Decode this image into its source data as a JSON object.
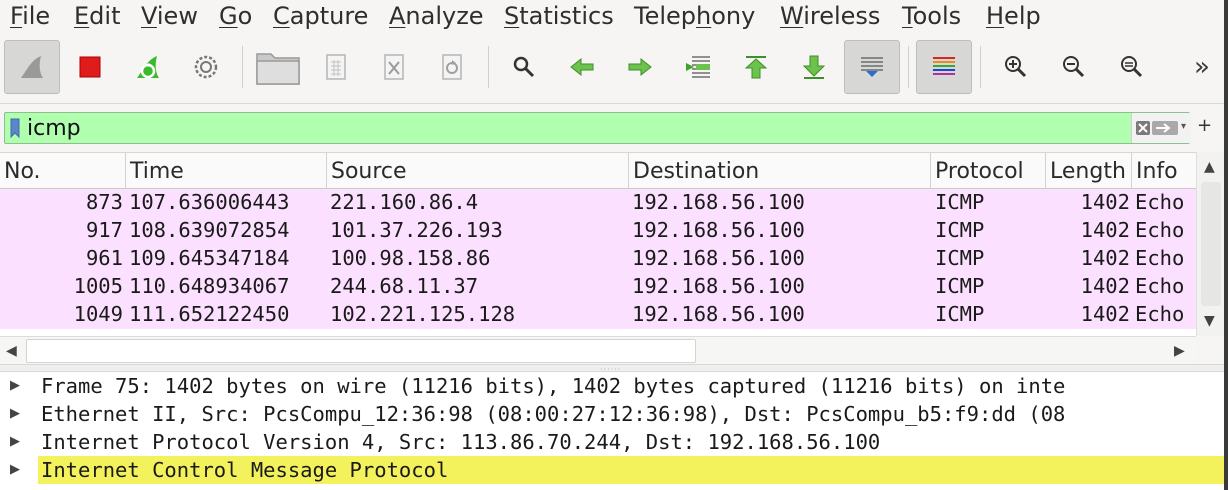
{
  "menu": [
    {
      "pre": "",
      "mn": "F",
      "post": "ile"
    },
    {
      "pre": "",
      "mn": "E",
      "post": "dit"
    },
    {
      "pre": "",
      "mn": "V",
      "post": "iew"
    },
    {
      "pre": "",
      "mn": "G",
      "post": "o"
    },
    {
      "pre": "",
      "mn": "C",
      "post": "apture"
    },
    {
      "pre": "",
      "mn": "A",
      "post": "nalyze"
    },
    {
      "pre": "",
      "mn": "S",
      "post": "tatistics"
    },
    {
      "pre": "Telep",
      "mn": "h",
      "post": "ony"
    },
    {
      "pre": "",
      "mn": "W",
      "post": "ireless"
    },
    {
      "pre": "",
      "mn": "T",
      "post": "ools"
    },
    {
      "pre": "",
      "mn": "H",
      "post": "elp"
    }
  ],
  "toolbar": {
    "icons": [
      "shark-fin-start-icon",
      "stop-square-icon",
      "restart-capture-icon",
      "capture-options-gear-icon",
      "open-folder-icon",
      "save-file-icon",
      "close-file-icon",
      "reload-file-icon",
      "find-magnifier-icon",
      "go-back-arrow-icon",
      "go-forward-arrow-icon",
      "go-to-packet-icon",
      "first-packet-icon",
      "last-packet-icon",
      "auto-scroll-icon",
      "colorize-icon",
      "zoom-in-icon",
      "zoom-out-icon",
      "zoom-normal-icon"
    ],
    "overflow": "»"
  },
  "filter": {
    "value": "icmp",
    "bg_color": "#afffaf",
    "plus": "+"
  },
  "packet_list": {
    "columns": [
      "No.",
      "Time",
      "Source",
      "Destination",
      "Protocol",
      "Length",
      "Info"
    ],
    "row_color": "#fce0ff",
    "rows": [
      {
        "no": "873",
        "time": "107.636006443",
        "source": "221.160.86.4",
        "destination": "192.168.56.100",
        "protocol": "ICMP",
        "length": "1402",
        "info": "Echo"
      },
      {
        "no": "917",
        "time": "108.639072854",
        "source": "101.37.226.193",
        "destination": "192.168.56.100",
        "protocol": "ICMP",
        "length": "1402",
        "info": "Echo"
      },
      {
        "no": "961",
        "time": "109.645347184",
        "source": "100.98.158.86",
        "destination": "192.168.56.100",
        "protocol": "ICMP",
        "length": "1402",
        "info": "Echo"
      },
      {
        "no": "1005",
        "time": "110.648934067",
        "source": "244.68.11.37",
        "destination": "192.168.56.100",
        "protocol": "ICMP",
        "length": "1402",
        "info": "Echo"
      },
      {
        "no": "1049",
        "time": "111.652122450",
        "source": "102.221.125.128",
        "destination": "192.168.56.100",
        "protocol": "ICMP",
        "length": "1402",
        "info": "Echo"
      }
    ]
  },
  "details": {
    "highlight_color": "#f4f25c",
    "rows": [
      "Frame 75: 1402 bytes on wire (11216 bits), 1402 bytes captured (11216 bits) on inte",
      "Ethernet II, Src: PcsCompu_12:36:98 (08:00:27:12:36:98), Dst: PcsCompu_b5:f9:dd (08",
      "Internet Protocol Version 4, Src: 113.86.70.244, Dst: 192.168.56.100",
      "Internet Control Message Protocol"
    ]
  }
}
